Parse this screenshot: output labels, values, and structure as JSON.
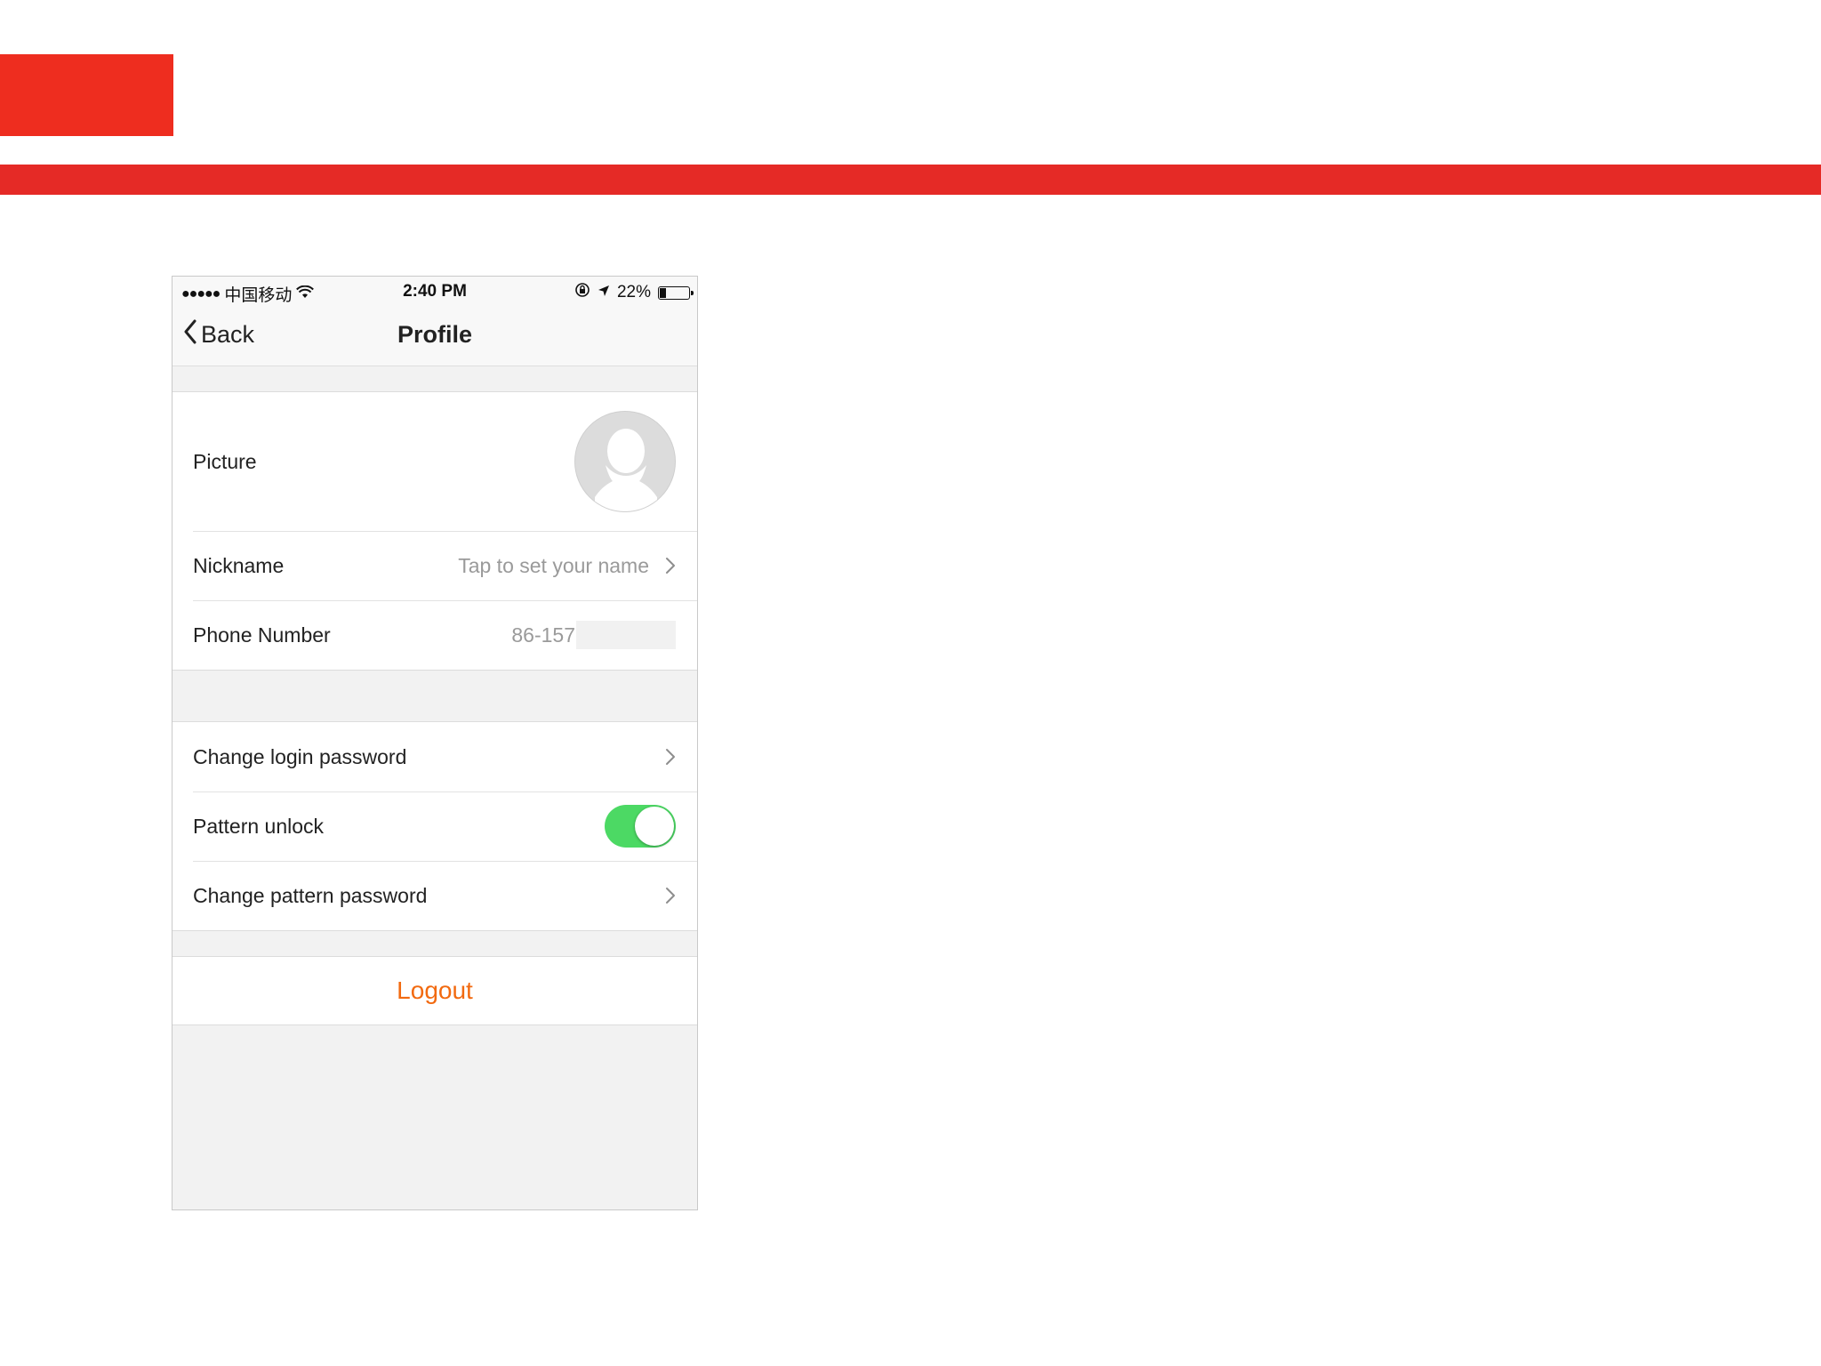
{
  "status_bar": {
    "signal": "●●●●●",
    "carrier": "中国移动",
    "time": "2:40 PM",
    "battery": "22%",
    "battery_fraction": 0.22
  },
  "nav": {
    "back_label": "Back",
    "title": "Profile"
  },
  "profile": {
    "picture_label": "Picture",
    "nickname_label": "Nickname",
    "nickname_placeholder": "Tap to set your name",
    "phone_label": "Phone Number",
    "phone_value": "86-157"
  },
  "security": {
    "change_login_label": "Change login password",
    "pattern_unlock_label": "Pattern unlock",
    "pattern_unlock_on": true,
    "change_pattern_label": "Change pattern password"
  },
  "logout_label": "Logout",
  "colors": {
    "accent_red": "#ee2d1f",
    "toggle_on": "#4cd964",
    "logout": "#f26a10"
  }
}
